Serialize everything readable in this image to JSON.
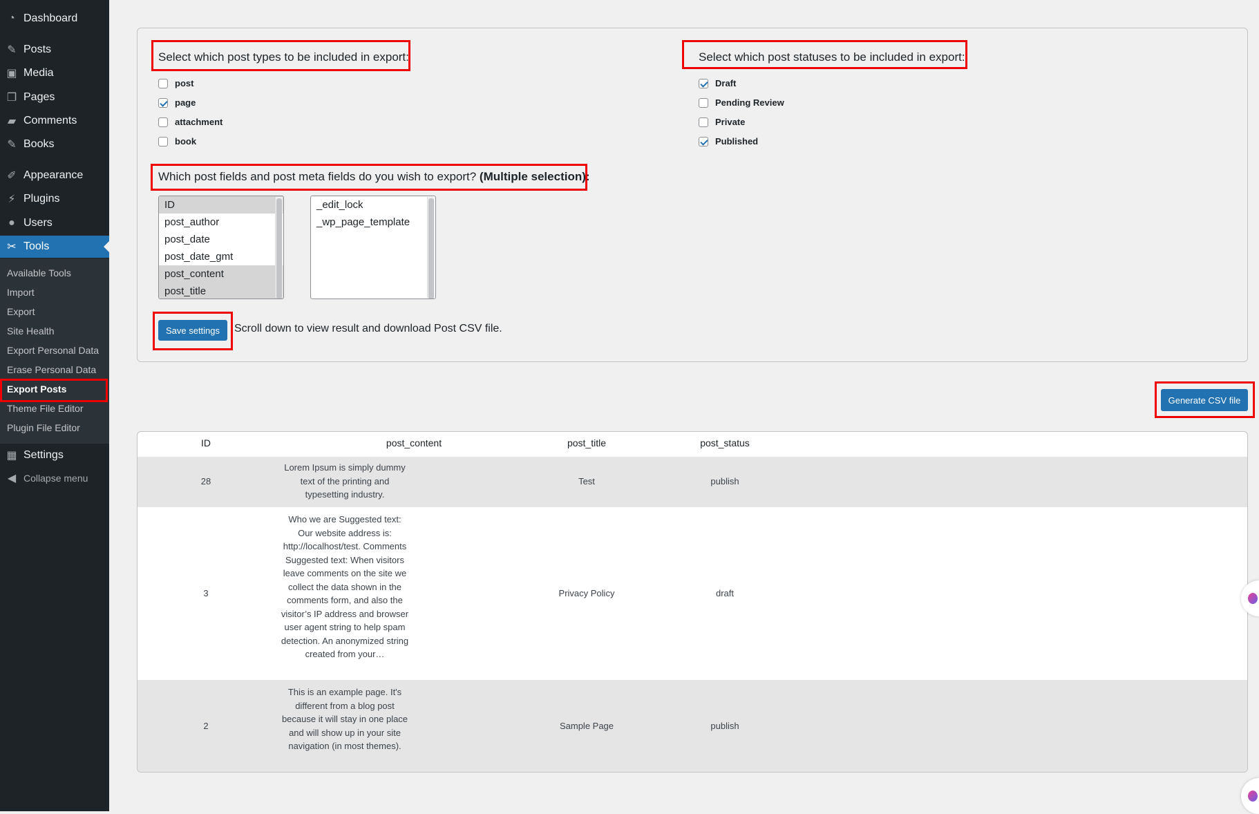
{
  "sidebar": {
    "menu": [
      {
        "label": "Dashboard",
        "icon": "dashboard-icon",
        "glyph": "◔"
      },
      {
        "label": "Posts",
        "icon": "pin-icon",
        "glyph": "✎"
      },
      {
        "label": "Media",
        "icon": "media-icon",
        "glyph": "▣"
      },
      {
        "label": "Pages",
        "icon": "pages-icon",
        "glyph": "❐"
      },
      {
        "label": "Comments",
        "icon": "comments-icon",
        "glyph": "▰"
      },
      {
        "label": "Books",
        "icon": "pin-icon",
        "glyph": "✎"
      },
      {
        "label": "Appearance",
        "icon": "brush-icon",
        "glyph": "✐"
      },
      {
        "label": "Plugins",
        "icon": "plugin-icon",
        "glyph": "⚡"
      },
      {
        "label": "Users",
        "icon": "user-icon",
        "glyph": "●"
      },
      {
        "label": "Tools",
        "icon": "wrench-icon",
        "glyph": "✂"
      },
      {
        "label": "Settings",
        "icon": "settings-icon",
        "glyph": "▦"
      }
    ],
    "submenu": [
      "Available Tools",
      "Import",
      "Export",
      "Site Health",
      "Export Personal Data",
      "Erase Personal Data",
      "Export Posts",
      "Theme File Editor",
      "Plugin File Editor"
    ],
    "collapse_label": "Collapse menu",
    "active_color": "#2271b1"
  },
  "settings": {
    "post_types_heading": "Select which post types to be included in export:",
    "post_types": [
      {
        "label": "post",
        "checked": false
      },
      {
        "label": "page",
        "checked": true
      },
      {
        "label": "attachment",
        "checked": false
      },
      {
        "label": "book",
        "checked": false
      }
    ],
    "statuses_heading": "Select which post statuses to be included in export:",
    "statuses": [
      {
        "label": "Draft",
        "checked": true
      },
      {
        "label": "Pending Review",
        "checked": false
      },
      {
        "label": "Private",
        "checked": false
      },
      {
        "label": "Published",
        "checked": true
      }
    ],
    "fields_heading_text": "Which post fields and post meta fields do you wish to export?",
    "fields_heading_bold": "(Multiple selection):",
    "post_fields": [
      {
        "label": "ID",
        "selected": true
      },
      {
        "label": "post_author",
        "selected": false
      },
      {
        "label": "post_date",
        "selected": false
      },
      {
        "label": "post_date_gmt",
        "selected": false
      },
      {
        "label": "post_content",
        "selected": true
      },
      {
        "label": "post_title",
        "selected": true
      }
    ],
    "meta_fields": [
      "_edit_lock",
      "_wp_page_template"
    ],
    "save_label": "Save settings",
    "save_hint": "Scroll down to view result and download Post CSV file."
  },
  "generate_label": "Generate CSV file",
  "table": {
    "headers": [
      "ID",
      "post_content",
      "post_title",
      "post_status"
    ],
    "rows": [
      {
        "id": "28",
        "content": "Lorem Ipsum is simply dummy text of the printing and typesetting industry.",
        "title": "Test",
        "status": "publish"
      },
      {
        "id": "3",
        "content": "Who we are Suggested text: Our website address is: http://localhost/test. Comments Suggested text: When visitors leave comments on the site we collect the data shown in the comments form, and also the visitor’s IP address and browser user agent string to help spam detection. An anonymized string created from your…",
        "title": "Privacy Policy",
        "status": "draft"
      },
      {
        "id": "2",
        "content": "This is an example page. It's different from a blog post because it will stay in one place and will show up in your site navigation (in most themes).",
        "title": "Sample Page",
        "status": "publish"
      }
    ]
  },
  "colors": {
    "highlight": "#ee0000",
    "primary": "#2271b1",
    "sidebar_bg": "#1d2327"
  }
}
